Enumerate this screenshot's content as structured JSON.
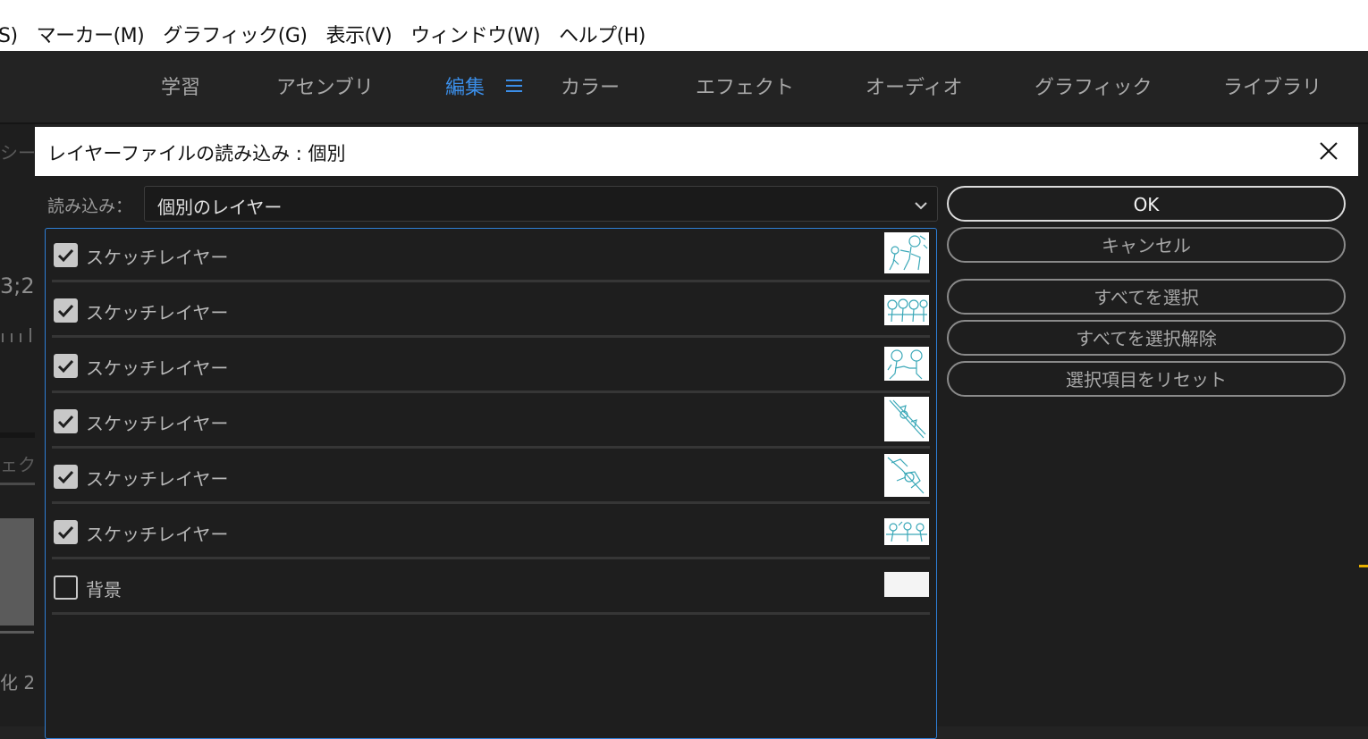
{
  "menubar": {
    "items": [
      "S)",
      "マーカー(M)",
      "グラフィック(G)",
      "表示(V)",
      "ウィンドウ(W)",
      "ヘルプ(H)"
    ]
  },
  "workspace": {
    "tabs": [
      {
        "label": "学習",
        "active": false
      },
      {
        "label": "アセンブリ",
        "active": false
      },
      {
        "label": "編集",
        "active": true
      },
      {
        "label": "カラー",
        "active": false
      },
      {
        "label": "エフェクト",
        "active": false
      },
      {
        "label": "オーディオ",
        "active": false
      },
      {
        "label": "グラフィック",
        "active": false
      },
      {
        "label": "ライブラリ",
        "active": false
      }
    ],
    "menu_icon": "hamburger-icon",
    "active_color": "#3b8ee8"
  },
  "background": {
    "fragments": [
      "シー",
      "3;2",
      "ェク",
      "化 2"
    ]
  },
  "dialog": {
    "title": "レイヤーファイルの読み込み : 個別",
    "close_icon": "close-icon",
    "import_label": "読み込み：",
    "import_value": "個別のレイヤー",
    "layers": [
      {
        "name": "スケッチレイヤー",
        "checked": true
      },
      {
        "name": "スケッチレイヤー",
        "checked": true
      },
      {
        "name": "スケッチレイヤー",
        "checked": true
      },
      {
        "name": "スケッチレイヤー",
        "checked": true
      },
      {
        "name": "スケッチレイヤー",
        "checked": true
      },
      {
        "name": "スケッチレイヤー",
        "checked": true
      },
      {
        "name": "背景",
        "checked": false
      }
    ],
    "buttons": {
      "ok": "OK",
      "cancel": "キャンセル",
      "select_all": "すべてを選択",
      "deselect_all": "すべてを選択解除",
      "reset": "選択項目をリセット"
    },
    "colors": {
      "list_border": "#2e7fd6",
      "sketch_stroke": "#3aa8b8"
    }
  }
}
